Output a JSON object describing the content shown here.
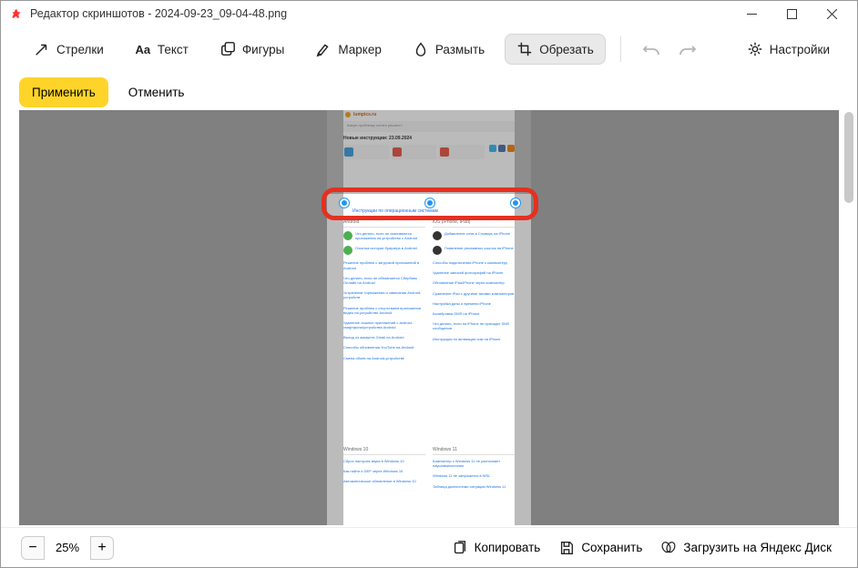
{
  "window": {
    "title": "Редактор скриншотов - 2024-09-23_09-04-48.png"
  },
  "toolbar": {
    "arrows": "Стрелки",
    "text": "Текст",
    "shapes": "Фигуры",
    "marker": "Маркер",
    "blur": "Размыть",
    "crop": "Обрезать",
    "settings": "Настройки"
  },
  "actions": {
    "apply": "Применить",
    "cancel": "Отменить"
  },
  "zoom": {
    "value": "25%"
  },
  "bottom": {
    "copy": "Копировать",
    "save": "Сохранить",
    "upload": "Загрузить на Яндекс Диск"
  },
  "content": {
    "siteName": "lumpics.ru",
    "searchPlaceholder": "Какую проблему хотите решить?",
    "newLabel": "Новые инструкции: 23.09.2024",
    "catLabel": "Инструкции по операционным системам",
    "colA": {
      "header": "Android",
      "links": [
        "Что делать, если не скачиваются приложения на устройство с Android",
        "Очистка истории браузера в Android",
        "Решение проблем с загрузкой приложений в Android",
        "Что делать, если не обновляется Сбербанк Онлайн на Android",
        "Устранение торможения и зависания Android-устройств",
        "Решение проблем с отсутствием приложения видео на устройстве Android",
        "Удаление лишних приложений с android-смартфона/устройства Android",
        "Выход из аккаунта Gmail на Android",
        "Способы обновления YouTube на Android",
        "Смена обоев на Android-устройстве"
      ]
    },
    "colB": {
      "header": "iOS (iPhone, iPad)",
      "links": [
        "Добавление слов в Словарь на iPhone",
        "Появление рекламных ссылок на iPhone",
        "Способы подключения iPhone к компьютеру",
        "Удаление записей фотографий на iPhone",
        "Обновление iPad/iPhone через компьютер",
        "Сравнение iPad с другими типами компьютеров",
        "Настройка даты и времени iPhone",
        "Калибровка GMS на iPhone",
        "Что делать, если на iPhone не приходят SMS сообщения",
        "Инструкция по активации сим на iPhone"
      ]
    },
    "colC": {
      "header": "Windows 10",
      "links": [
        "Сброс настроек звука в Windows 10",
        "Как найти и DEP через Windows 10",
        "Автоматическое обновление в Windows 10"
      ]
    },
    "colD": {
      "header": "Windows 11",
      "links": [
        "Компьютер с Windows 11 не распознает наушники/колонки",
        "Windows 11 не запускается в WSL",
        "Таблица диагностики ситуации Windows 11"
      ]
    }
  }
}
